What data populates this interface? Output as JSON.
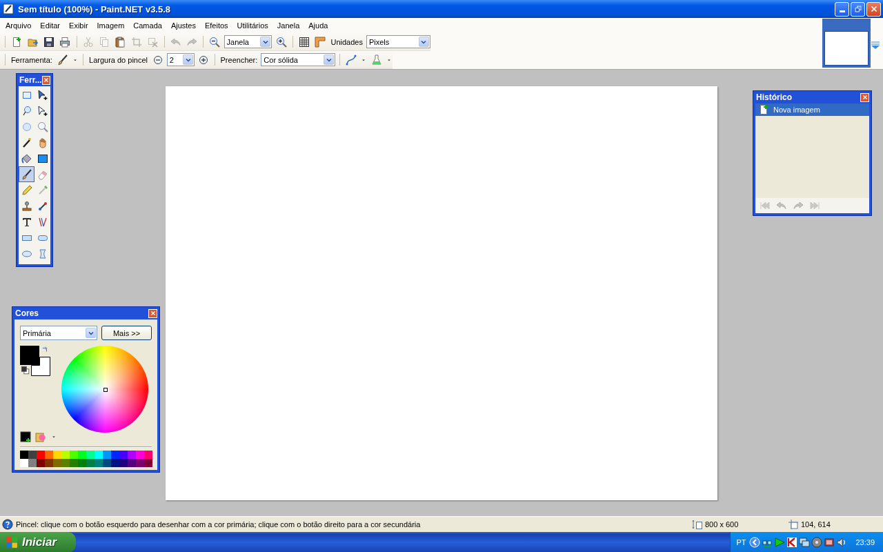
{
  "window": {
    "title": "Sem título (100%) - Paint.NET v3.5.8"
  },
  "menu": [
    {
      "label": "Arquivo"
    },
    {
      "label": "Editar"
    },
    {
      "label": "Exibir"
    },
    {
      "label": "Imagem"
    },
    {
      "label": "Camada"
    },
    {
      "label": "Ajustes"
    },
    {
      "label": "Efeitos"
    },
    {
      "label": "Utilitários"
    },
    {
      "label": "Janela"
    },
    {
      "label": "Ajuda"
    }
  ],
  "toolbar": [
    {
      "kind": "separator"
    },
    {
      "kind": "new",
      "disabled": false
    },
    {
      "kind": "open",
      "disabled": false
    },
    {
      "kind": "save",
      "disabled": false
    },
    {
      "kind": "print",
      "disabled": false
    },
    {
      "kind": "separator"
    },
    {
      "kind": "cut",
      "disabled": true
    },
    {
      "kind": "copy",
      "disabled": true
    },
    {
      "kind": "paste",
      "disabled": false
    },
    {
      "kind": "crop",
      "disabled": true
    },
    {
      "kind": "deselect",
      "disabled": true
    },
    {
      "kind": "separator"
    },
    {
      "kind": "undo",
      "disabled": true
    },
    {
      "kind": "redo",
      "disabled": true
    },
    {
      "kind": "separator"
    },
    {
      "kind": "zoom-out",
      "disabled": false
    },
    {
      "kind": "zoom-select",
      "value": "Janela"
    },
    {
      "kind": "zoom-in",
      "disabled": false
    },
    {
      "kind": "separator"
    },
    {
      "kind": "grid",
      "disabled": false
    },
    {
      "kind": "ruler",
      "disabled": false
    },
    {
      "kind": "label",
      "label": "Unidades"
    },
    {
      "kind": "units-select",
      "value": "Pixels"
    }
  ],
  "tool_options": [
    {
      "kind": "separator"
    },
    {
      "kind": "label",
      "label": "Ferramenta:"
    },
    {
      "kind": "brush",
      "disabled": false
    },
    {
      "kind": "caret",
      "disabled": false
    },
    {
      "kind": "separator"
    },
    {
      "kind": "label",
      "label": "Largura do pincel"
    },
    {
      "kind": "minus",
      "disabled": false
    },
    {
      "kind": "width-select",
      "value": "2"
    },
    {
      "kind": "plus",
      "disabled": false
    },
    {
      "kind": "separator"
    },
    {
      "kind": "label",
      "label": "Preencher:"
    },
    {
      "kind": "fill-select",
      "value": "Cor sólida"
    },
    {
      "kind": "separator"
    },
    {
      "kind": "curve",
      "disabled": false
    },
    {
      "kind": "caret",
      "disabled": false
    },
    {
      "kind": "flask",
      "disabled": false
    },
    {
      "kind": "caret",
      "disabled": false
    }
  ],
  "tools_window": {
    "title": "Ferr...",
    "tools": [
      {
        "kind": "rect-select",
        "selected": false
      },
      {
        "kind": "move-selected",
        "selected": false
      },
      {
        "kind": "lasso",
        "selected": false
      },
      {
        "kind": "move-selection",
        "selected": false
      },
      {
        "kind": "ellipse-select",
        "selected": false
      },
      {
        "kind": "zoom",
        "selected": false
      },
      {
        "kind": "magic-wand",
        "selected": false
      },
      {
        "kind": "pan",
        "selected": false
      },
      {
        "kind": "bucket",
        "selected": false
      },
      {
        "kind": "gradient",
        "selected": false
      },
      {
        "kind": "brush",
        "selected": true
      },
      {
        "kind": "eraser",
        "selected": false
      },
      {
        "kind": "pencil",
        "selected": false
      },
      {
        "kind": "picker",
        "selected": false
      },
      {
        "kind": "stamp",
        "selected": false
      },
      {
        "kind": "recolor",
        "selected": false
      },
      {
        "kind": "text",
        "selected": false
      },
      {
        "kind": "line",
        "selected": false
      },
      {
        "kind": "rectangle",
        "selected": false
      },
      {
        "kind": "rounded-rect",
        "selected": false
      },
      {
        "kind": "ellipse",
        "selected": false
      },
      {
        "kind": "freeform",
        "selected": false
      }
    ]
  },
  "colors_window": {
    "title": "Cores",
    "mode": {
      "value": "Primária"
    },
    "more_button": "Mais >>",
    "primary_swatch": {
      "color": "#000000"
    },
    "secondary_swatch": {
      "color": "#ffffff"
    },
    "palette": [
      {
        "color": "#000000"
      },
      {
        "color": "#404040"
      },
      {
        "color": "#ff0000"
      },
      {
        "color": "#ff6a00"
      },
      {
        "color": "#ffd800"
      },
      {
        "color": "#b6ff00"
      },
      {
        "color": "#4cff00"
      },
      {
        "color": "#00ff21"
      },
      {
        "color": "#00ff90"
      },
      {
        "color": "#00ffff"
      },
      {
        "color": "#0094ff"
      },
      {
        "color": "#0026ff"
      },
      {
        "color": "#4800ff"
      },
      {
        "color": "#b200ff"
      },
      {
        "color": "#ff00dc"
      },
      {
        "color": "#ff006e"
      },
      {
        "color": "#ffffff"
      },
      {
        "color": "#808080"
      },
      {
        "color": "#7f0000"
      },
      {
        "color": "#7f3300"
      },
      {
        "color": "#7f6a00"
      },
      {
        "color": "#5b7f00"
      },
      {
        "color": "#267f00"
      },
      {
        "color": "#007f0e"
      },
      {
        "color": "#007f46"
      },
      {
        "color": "#007f7f"
      },
      {
        "color": "#004a7f"
      },
      {
        "color": "#00137f"
      },
      {
        "color": "#21007f"
      },
      {
        "color": "#57007f"
      },
      {
        "color": "#7f006e"
      },
      {
        "color": "#7f0037"
      }
    ]
  },
  "history_window": {
    "title": "Histórico",
    "items": [
      {
        "label": "Nova imagem",
        "selected": true
      }
    ],
    "controls": [
      {
        "kind": "first",
        "disabled": true
      },
      {
        "kind": "undo",
        "disabled": true
      },
      {
        "kind": "redo",
        "disabled": true
      },
      {
        "kind": "last",
        "disabled": true
      }
    ]
  },
  "status_bar": {
    "hint": "Pincel: clique com o botão esquerdo para desenhar com a cor primária; clique com o botão direito para a cor secundária",
    "image_size": "800 x 600",
    "cursor_position": "104, 614"
  },
  "taskbar": {
    "start": "Iniciar",
    "language": "PT",
    "clock": "23:39"
  }
}
